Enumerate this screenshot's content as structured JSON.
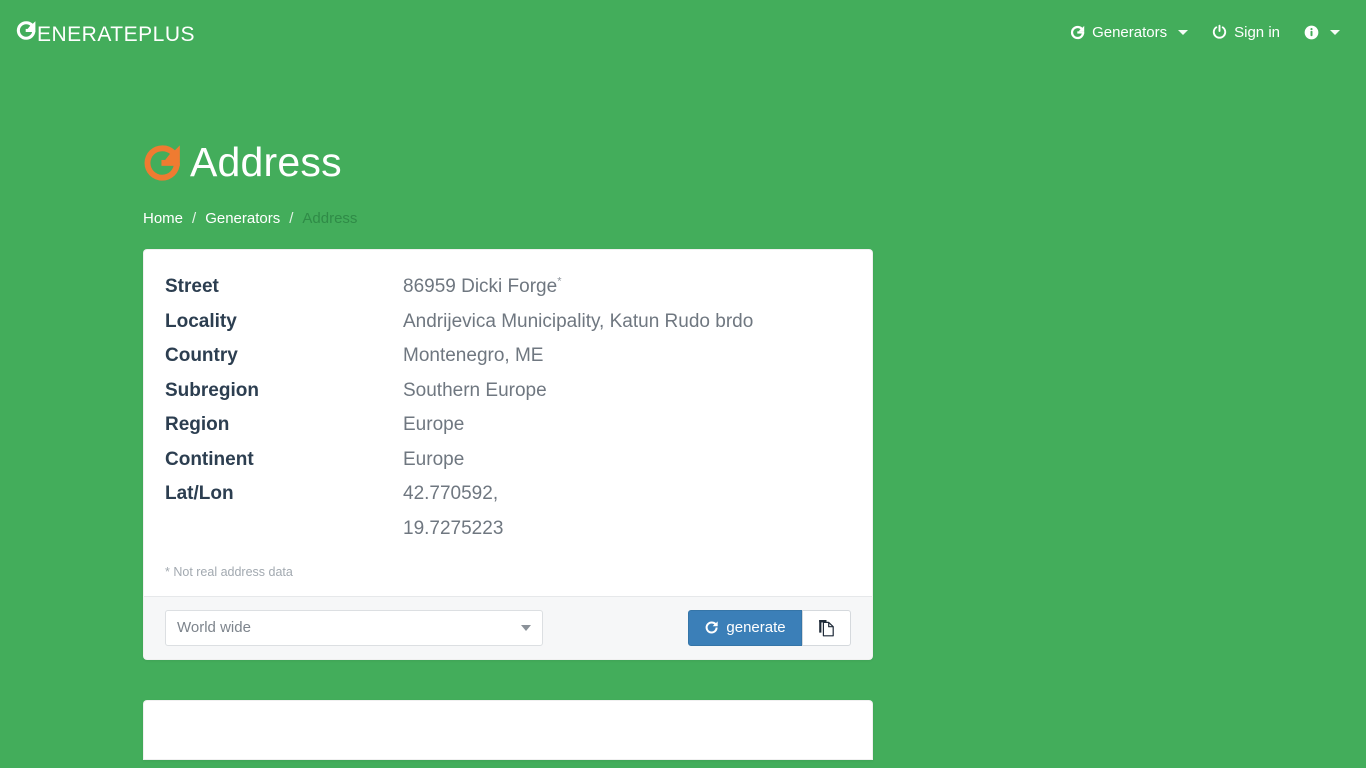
{
  "brand": {
    "icon": "refresh-g-icon",
    "initial": "G",
    "rest": "ENERATEPLUS"
  },
  "nav": {
    "generators": {
      "icon": "refresh-g-icon",
      "label": "Generators",
      "caret": "caret-down-icon"
    },
    "signin": {
      "icon": "power-icon",
      "label": "Sign in"
    },
    "info": {
      "icon": "info-circle-icon",
      "caret": "caret-down-icon"
    }
  },
  "page": {
    "icon": "refresh-g-icon-orange",
    "title": "Address"
  },
  "breadcrumb": {
    "items": [
      {
        "label": "Home",
        "active": false
      },
      {
        "label": "Generators",
        "active": false
      },
      {
        "label": "Address",
        "active": true
      }
    ],
    "separator": "/"
  },
  "address": {
    "rows": [
      {
        "label": "Street",
        "value": "86959 Dicki Forge",
        "footnote_marker": "*"
      },
      {
        "label": "Locality",
        "value": "Andrijevica Municipality, Katun Rudo brdo"
      },
      {
        "label": "Country",
        "value": "Montenegro, ME"
      },
      {
        "label": "Subregion",
        "value": "Southern Europe"
      },
      {
        "label": "Region",
        "value": "Europe"
      },
      {
        "label": "Continent",
        "value": "Europe"
      },
      {
        "label": "Lat/Lon",
        "value": "42.770592,\n19.7275223"
      }
    ],
    "footnote": "* Not real address data"
  },
  "controls": {
    "region_select": {
      "value": "World wide",
      "options": [
        "World wide"
      ]
    },
    "generate_button": {
      "icon": "refresh-icon",
      "label": "generate"
    },
    "copy_button": {
      "icon": "copy-icon",
      "label": ""
    }
  },
  "colors": {
    "background_green": "#43ad5b",
    "brand_orange": "#ef7b31",
    "primary_blue": "#3b7fb8",
    "label_dark": "#2c3e50",
    "value_gray": "#6f7780",
    "muted": "#a2a9b0"
  }
}
